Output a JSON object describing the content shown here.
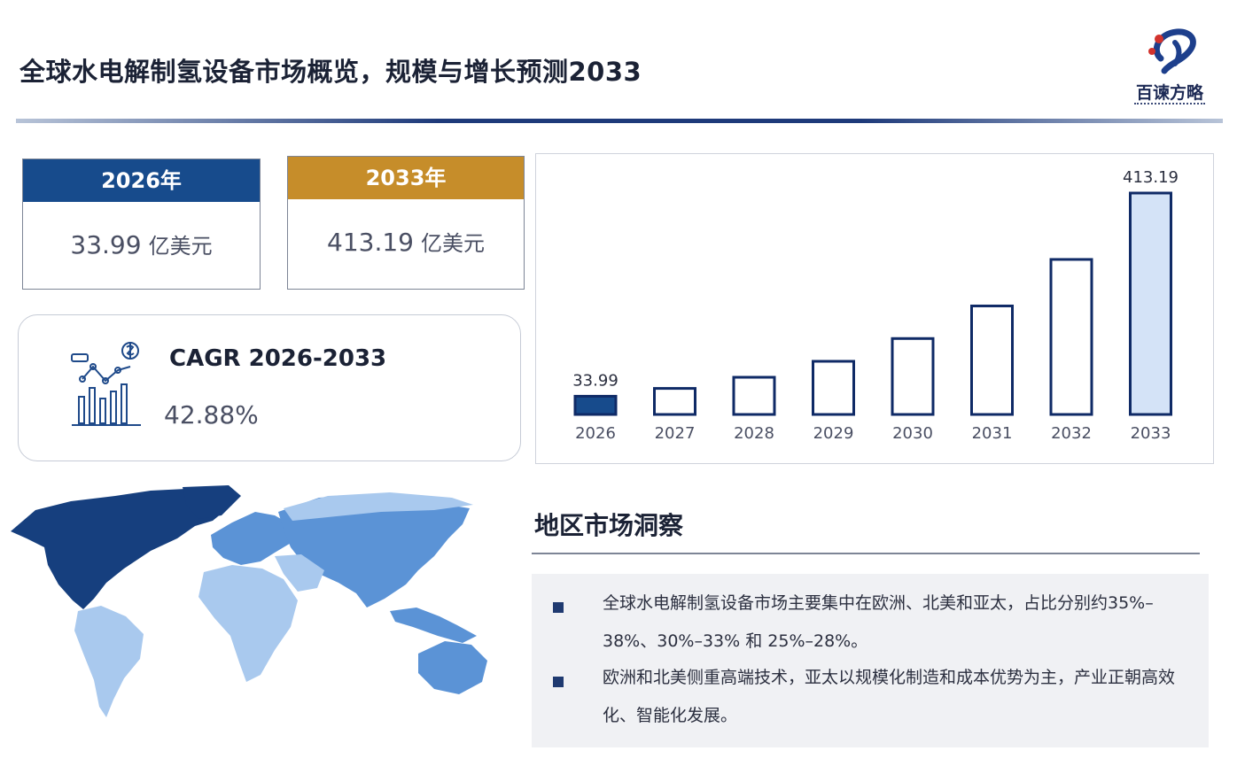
{
  "header": {
    "title": "全球水电解制氢设备市场概览，规模与增长预测2033",
    "logo_text": "百谏方略"
  },
  "kpis": [
    {
      "year_label": "2026年",
      "value": "33.99",
      "unit": "亿美元",
      "color": "#174b8c"
    },
    {
      "year_label": "2033年",
      "value": "413.19",
      "unit": "亿美元",
      "color": "#c68d2a"
    }
  ],
  "cagr": {
    "label": "CAGR 2026-2033",
    "value": "42.88%",
    "icon": "growth-chart-icon"
  },
  "chart_data": {
    "type": "bar",
    "categories": [
      "2026",
      "2027",
      "2028",
      "2029",
      "2030",
      "2031",
      "2032",
      "2033"
    ],
    "values": [
      33.99,
      48.6,
      69.4,
      99.2,
      141.7,
      202.5,
      289.3,
      413.19
    ],
    "data_labels": [
      "33.99",
      "",
      "",
      "",
      "",
      "",
      "",
      "413.19"
    ],
    "ylim": [
      0,
      413.19
    ],
    "grid": false,
    "colors": {
      "outline": "#0f2a66",
      "first_fill": "#174b8c",
      "last_fill": "#d4e3f7"
    }
  },
  "region": {
    "title": "地区市场洞察",
    "bullets": [
      "全球水电解制氢设备市场主要集中在欧洲、北美和亚太，占比分别约35%–38%、30%–33% 和 25%–28%。",
      "欧洲和北美侧重高端技术，亚太以规模化制造和成本优势为主，产业正朝高效化、智能化发展。"
    ]
  },
  "map": {
    "icon": "world-map-icon",
    "colors": {
      "north_america": "#163f7e",
      "europe_asia": "#5b93d6",
      "other": "#a9c9ee"
    }
  }
}
